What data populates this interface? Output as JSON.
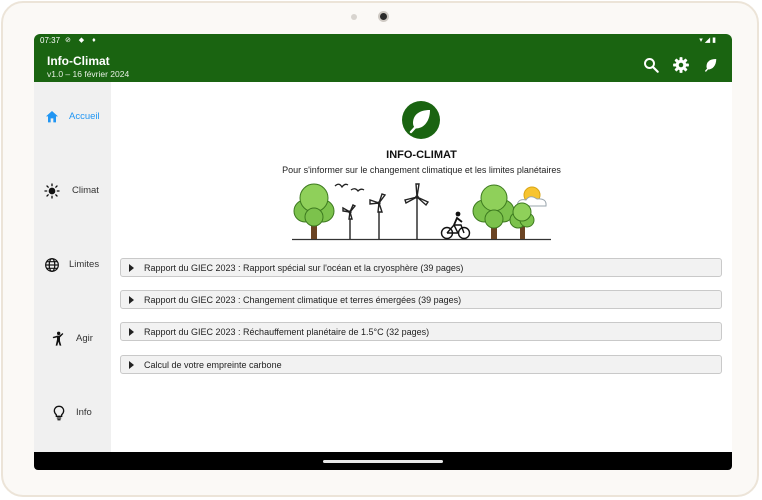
{
  "status": {
    "time": "07:37"
  },
  "app": {
    "title": "Info-Climat",
    "subtitle": "v1.0 – 16 février 2024"
  },
  "appbar_icons": [
    "search-icon",
    "gear-icon",
    "leaf-icon"
  ],
  "nav": {
    "items": [
      {
        "label": "Accueil",
        "icon": "home-icon",
        "active": true
      },
      {
        "label": "Climat",
        "icon": "sun-icon",
        "active": false
      },
      {
        "label": "Limites",
        "icon": "globe-icon",
        "active": false
      },
      {
        "label": "Agir",
        "icon": "person-icon",
        "active": false
      },
      {
        "label": "Info",
        "icon": "lightbulb-icon",
        "active": false
      }
    ]
  },
  "hero": {
    "brand": "INFO-CLIMAT",
    "tagline": "Pour s'informer sur le changement climatique et les limites planétaires"
  },
  "accordions": [
    {
      "label": "Rapport du GIEC 2023 : Rapport spécial sur l'océan et la cryosphère (39 pages)"
    },
    {
      "label": "Rapport du GIEC 2023 : Changement climatique et terres émergées (39 pages)"
    },
    {
      "label": "Rapport du GIEC 2023 : Réchauffement planétaire de 1.5°C (32 pages)"
    },
    {
      "label": "Calcul de votre empreinte carbone"
    }
  ],
  "colors": {
    "primary": "#1a6411",
    "accent": "#2196f3",
    "tree": "#7cc24c"
  }
}
